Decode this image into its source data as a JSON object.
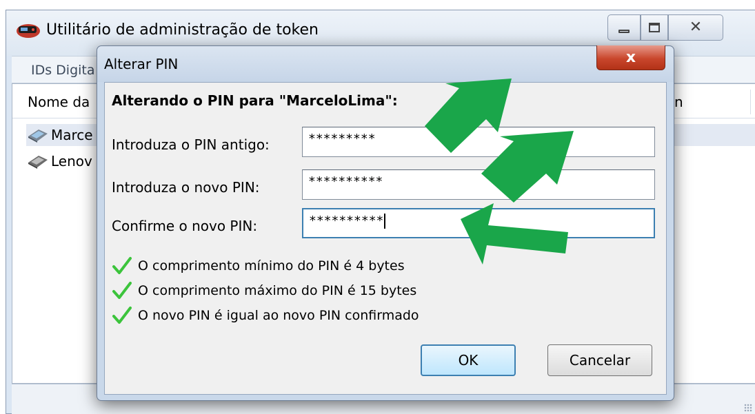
{
  "main_window": {
    "title": "Utilitário de administração de token",
    "menubar_first": "IDs Digita",
    "list": {
      "header_name": "Nome da",
      "header_right_fragment": "n",
      "rows": [
        "Marce",
        "Lenov"
      ]
    }
  },
  "dialog": {
    "title": "Alterar PIN",
    "close_glyph": "x",
    "heading": "Alterando o PIN para \"MarceloLima\":",
    "fields": {
      "old_pin_label": "Introduza o PIN antigo:",
      "old_pin_value": "*********",
      "new_pin_label": "Introduza o novo PIN:",
      "new_pin_value": "**********",
      "confirm_pin_label": "Confirme o novo PIN:",
      "confirm_pin_value": "**********"
    },
    "rules": [
      "O comprimento mínimo do PIN é 4 bytes",
      "O comprimento máximo do PIN é 15 bytes",
      "O novo PIN é igual ao novo PIN confirmado"
    ],
    "ok_label": "OK",
    "cancel_label": "Cancelar"
  },
  "colors": {
    "arrow": "#1aa64a",
    "check": "#3cc43c",
    "close_button": "#c9462c"
  },
  "icons": [
    "app-token-icon",
    "token-device-icon",
    "check-icon",
    "arrow-annotation"
  ]
}
